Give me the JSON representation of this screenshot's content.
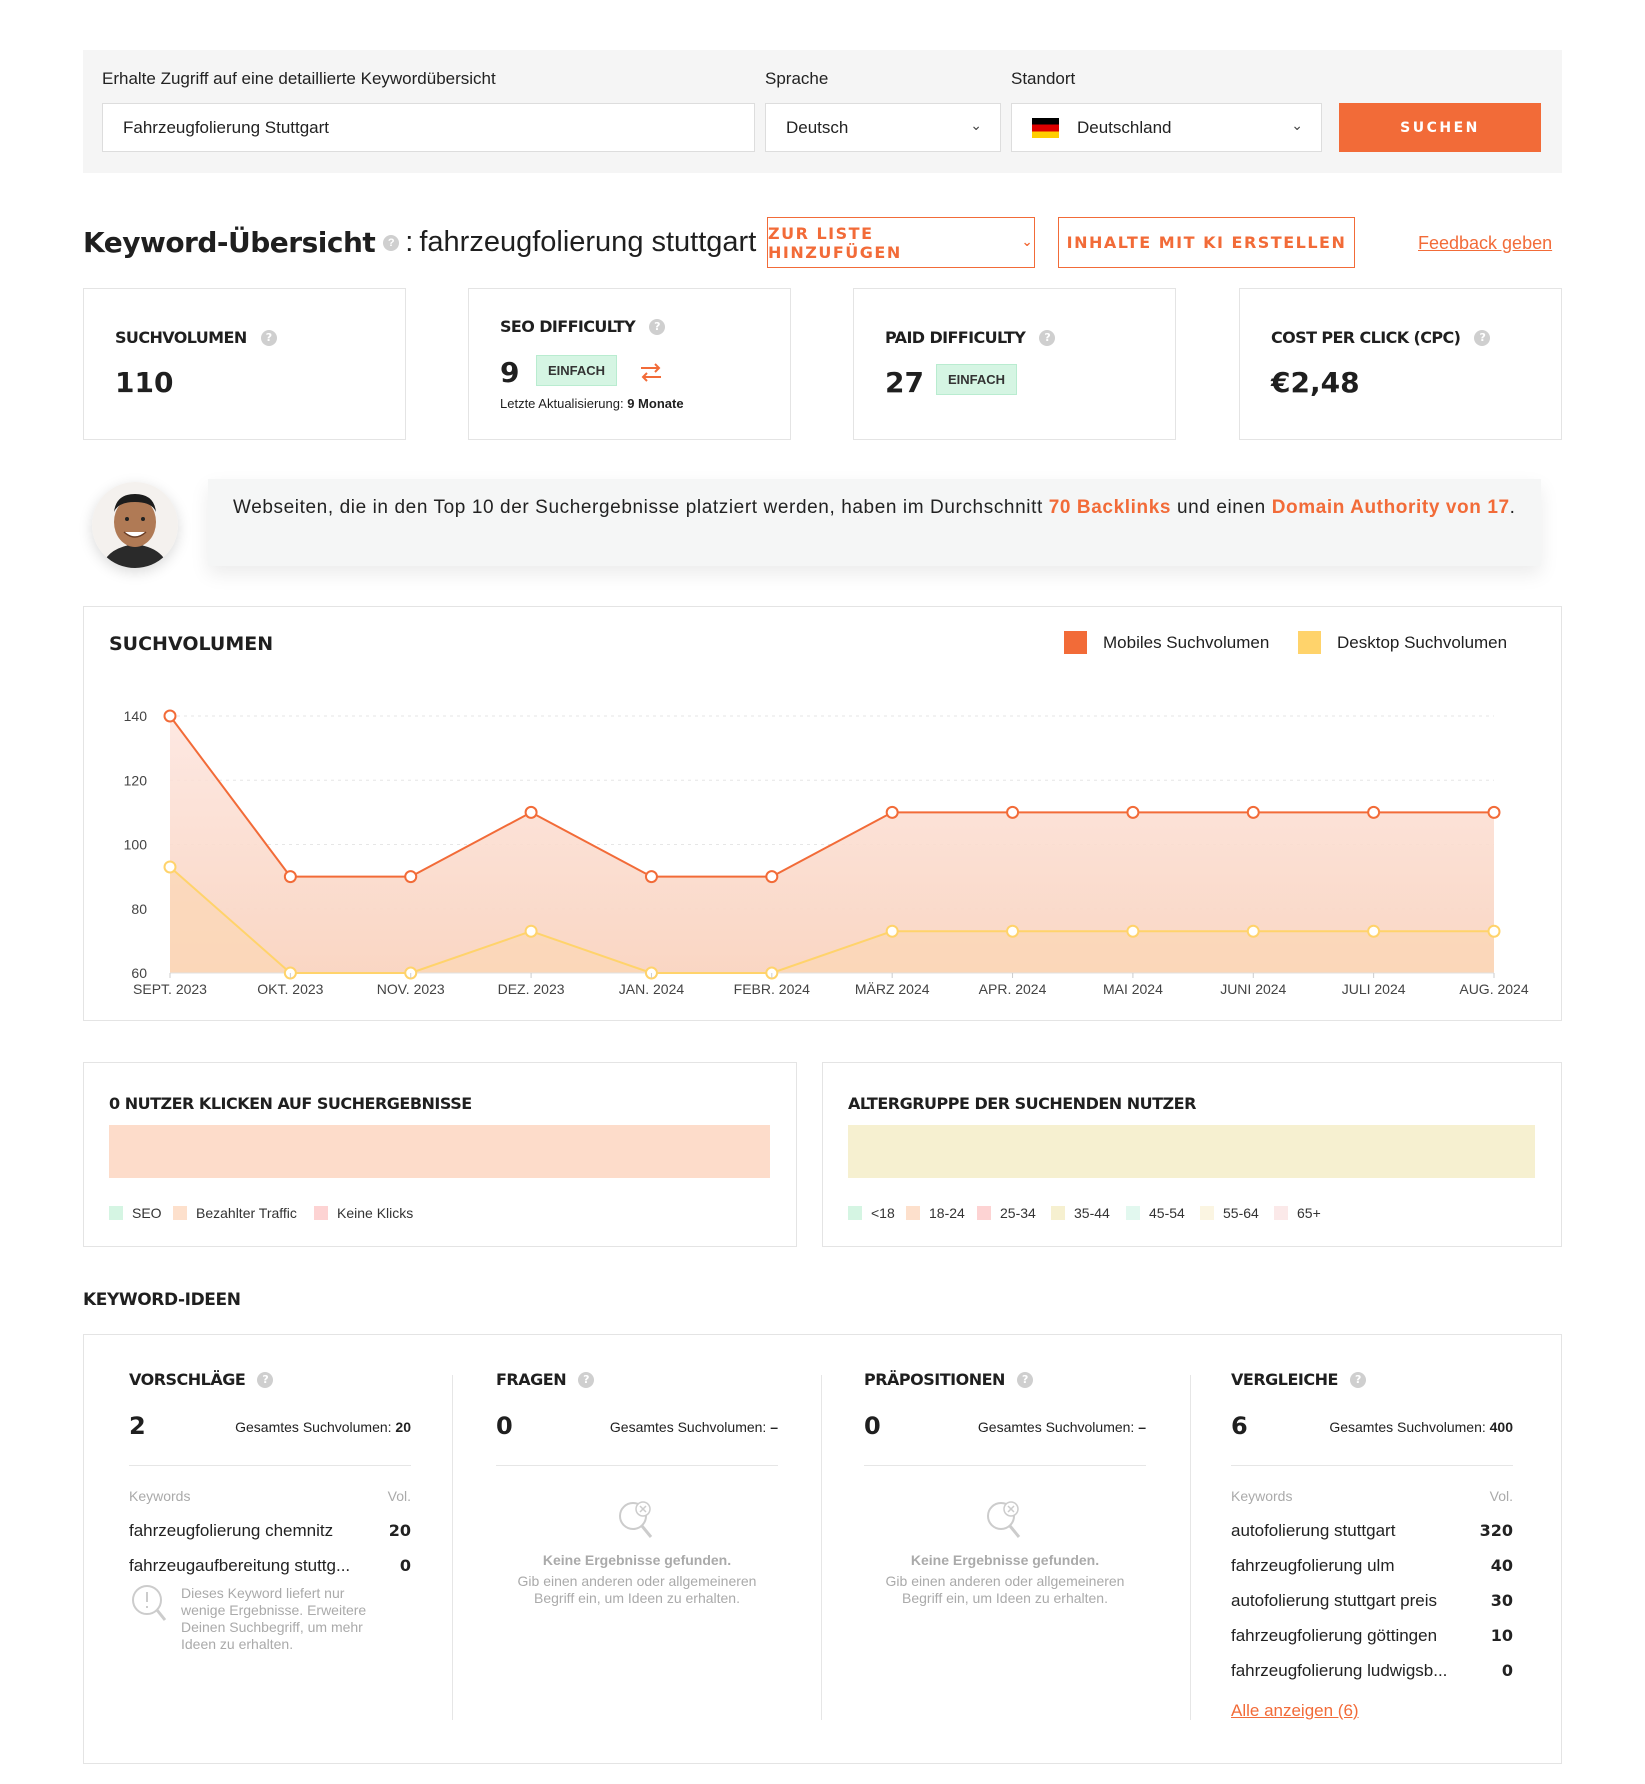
{
  "search": {
    "keyword_label": "Erhalte Zugriff auf eine detaillierte Keywordübersicht",
    "keyword_value": "Fahrzeugfolierung Stuttgart",
    "language_label": "Sprache",
    "language_value": "Deutsch",
    "location_label": "Standort",
    "location_value": "Deutschland",
    "button": "SUCHEN"
  },
  "overview": {
    "title": "Keyword-Übersicht",
    "separator": ":",
    "keyword": "fahrzeugfolierung stuttgart",
    "add_to_list": "ZUR LISTE HINZUFÜGEN",
    "create_ai": "INHALTE MIT KI ERSTELLEN",
    "feedback": "Feedback geben"
  },
  "metrics": {
    "volume": {
      "label": "SUCHVOLUMEN",
      "value": "110"
    },
    "seo": {
      "label": "SEO DIFFICULTY",
      "value": "9",
      "badge": "EINFACH",
      "updated_label": "Letzte Aktualisierung:",
      "updated_value": "9 Monate"
    },
    "paid": {
      "label": "PAID DIFFICULTY",
      "value": "27",
      "badge": "EINFACH"
    },
    "cpc": {
      "label": "COST PER CLICK (CPC)",
      "value": "€2,48"
    }
  },
  "tip": {
    "pre": "Webseiten, die in den Top 10 der Suchergebnisse platziert werden, haben im Durchschnitt ",
    "backlinks": "70 Backlinks",
    "mid": " und einen ",
    "authority": "Domain Authority von 17",
    "post": "."
  },
  "chart": {
    "title": "SUCHVOLUMEN",
    "legend_mobile": "Mobiles Suchvolumen",
    "legend_desktop": "Desktop Suchvolumen"
  },
  "chart_data": {
    "type": "area",
    "title": "SUCHVOLUMEN",
    "categories": [
      "SEPT. 2023",
      "OKT. 2023",
      "NOV. 2023",
      "DEZ. 2023",
      "JAN. 2024",
      "FEBR. 2024",
      "MÄRZ 2024",
      "APR. 2024",
      "MAI 2024",
      "JUNI 2024",
      "JULI 2024",
      "AUG. 2024"
    ],
    "series": [
      {
        "name": "Mobiles Suchvolumen",
        "color": "#f26b38",
        "values": [
          140,
          90,
          90,
          110,
          90,
          90,
          110,
          110,
          110,
          110,
          110,
          110
        ]
      },
      {
        "name": "Desktop Suchvolumen",
        "color": "#ffd36b",
        "values": [
          93,
          60,
          60,
          73,
          60,
          60,
          73,
          73,
          73,
          73,
          73,
          73
        ]
      }
    ],
    "yticks": [
      60,
      80,
      100,
      120,
      140
    ],
    "ylim": [
      60,
      140
    ],
    "grid": true,
    "legend": "top-right"
  },
  "clicks": {
    "title": "0 NUTZER KLICKEN AUF SUCHERGEBNISSE",
    "legend": [
      {
        "label": "SEO",
        "color": "#d5f5e3"
      },
      {
        "label": "Bezahlter Traffic",
        "color": "#fde0cc"
      },
      {
        "label": "Keine Klicks",
        "color": "#fdd3d3"
      }
    ]
  },
  "age": {
    "title": "ALTERGRUPPE DER SUCHENDEN NUTZER",
    "legend": [
      {
        "label": "<18",
        "color": "#d5f5e3"
      },
      {
        "label": "18-24",
        "color": "#fde0cc"
      },
      {
        "label": "25-34",
        "color": "#fdd3d3"
      },
      {
        "label": "35-44",
        "color": "#f6f0d0"
      },
      {
        "label": "45-54",
        "color": "#e2f8ef"
      },
      {
        "label": "55-64",
        "color": "#fbf5e2"
      },
      {
        "label": "65+",
        "color": "#fbe9e9"
      }
    ]
  },
  "ideas": {
    "title": "KEYWORD-IDEEN",
    "total_label": "Gesamtes Suchvolumen:",
    "keywords_header": "Keywords",
    "vol_header": "Vol.",
    "no_results_title": "Keine Ergebnisse gefunden.",
    "no_results_text": "Gib einen anderen oder allgemeineren Begriff ein, um Ideen zu erhalten.",
    "suggestions": {
      "title": "VORSCHLÄGE",
      "count": "2",
      "total": "20",
      "rows": [
        {
          "kw": "fahrzeugfolierung chemnitz",
          "vol": "20"
        },
        {
          "kw": "fahrzeugaufbereitung stuttg...",
          "vol": "0"
        }
      ],
      "note": "Dieses Keyword liefert nur wenige Ergebnisse. Erweitere Deinen Suchbegriff, um mehr Ideen zu erhalten."
    },
    "questions": {
      "title": "FRAGEN",
      "count": "0",
      "total": "–"
    },
    "prepositions": {
      "title": "PRÄPOSITIONEN",
      "count": "0",
      "total": "–"
    },
    "comparisons": {
      "title": "VERGLEICHE",
      "count": "6",
      "total": "400",
      "rows": [
        {
          "kw": "autofolierung stuttgart",
          "vol": "320"
        },
        {
          "kw": "fahrzeugfolierung ulm",
          "vol": "40"
        },
        {
          "kw": "autofolierung stuttgart preis",
          "vol": "30"
        },
        {
          "kw": "fahrzeugfolierung göttingen",
          "vol": "10"
        },
        {
          "kw": "fahrzeugfolierung ludwigsb...",
          "vol": "0"
        }
      ],
      "show_all": "Alle anzeigen (6)"
    }
  }
}
